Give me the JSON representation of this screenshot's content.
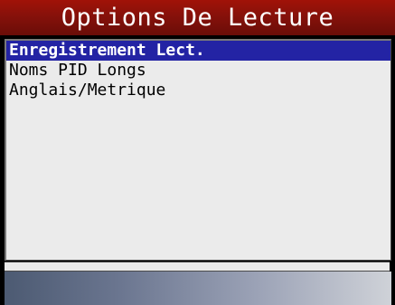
{
  "screen": {
    "title": "Options De Lecture"
  },
  "menu": {
    "items": [
      {
        "label": "Enregistrement Lect.",
        "selected": true
      },
      {
        "label": "Noms PID Longs",
        "selected": false
      },
      {
        "label": "Anglais/Metrique",
        "selected": false
      }
    ]
  },
  "colors": {
    "title_bar": "#86110a",
    "selection_highlight": "#2323a4",
    "list_background": "#ebebeb",
    "bottom_bar_start": "#4c5a72",
    "bottom_bar_end": "#cfd2d8"
  }
}
